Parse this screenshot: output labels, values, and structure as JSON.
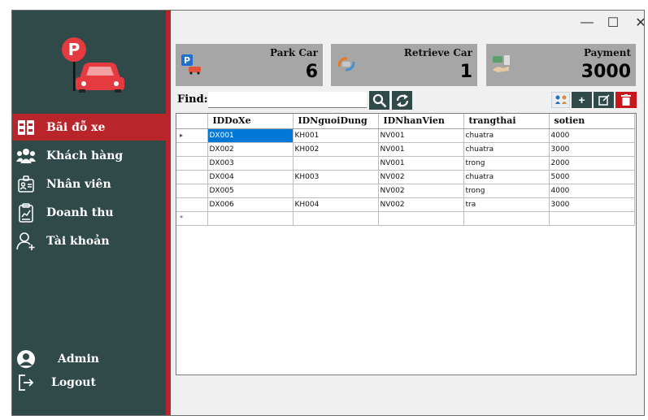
{
  "sidebar": {
    "items": [
      {
        "label": "Bãi đỗ xe",
        "icon": "parking-lot-icon",
        "active": true
      },
      {
        "label": "Khách hàng",
        "icon": "customers-icon",
        "active": false
      },
      {
        "label": "Nhân viên",
        "icon": "employee-badge-icon",
        "active": false
      },
      {
        "label": "Doanh thu",
        "icon": "revenue-clipboard-icon",
        "active": false
      },
      {
        "label": "Tài khoản",
        "icon": "account-add-icon",
        "active": false
      }
    ],
    "user": {
      "name": "Admin",
      "icon": "user-avatar-icon"
    },
    "logout": {
      "label": "Logout",
      "icon": "logout-icon"
    }
  },
  "titlebar": {
    "minimize": "—",
    "maximize": "☐",
    "close": "✕"
  },
  "cards": [
    {
      "title": "Park Car",
      "value": "6",
      "icon": "park-car-icon"
    },
    {
      "title": "Retrieve Car",
      "value": "1",
      "icon": "retrieve-car-icon"
    },
    {
      "title": "Payment",
      "value": "3000",
      "icon": "payment-icon"
    }
  ],
  "find": {
    "label": "Find:",
    "value": ""
  },
  "toolbar": {
    "add": "+"
  },
  "table": {
    "columns": [
      "IDDoXe",
      "IDNguoiDung",
      "IDNhanVien",
      "trangthai",
      "sotien"
    ],
    "rows": [
      [
        "DX001",
        "KH001",
        "NV001",
        "chuatra",
        "4000"
      ],
      [
        "DX002",
        "KH002",
        "NV001",
        "chuatra",
        "3000"
      ],
      [
        "DX003",
        "",
        "NV001",
        "trong",
        "2000"
      ],
      [
        "DX004",
        "KH003",
        "NV002",
        "chuatra",
        "5000"
      ],
      [
        "DX005",
        "",
        "NV002",
        "trong",
        "4000"
      ],
      [
        "DX006",
        "KH004",
        "NV002",
        "tra",
        "3000"
      ]
    ],
    "current_marker": "▸",
    "new_row_marker": "*"
  },
  "colors": {
    "sidebar": "#2f4a49",
    "accent": "#b9252b",
    "card": "#a6a6a6",
    "selection": "#0078d7"
  }
}
